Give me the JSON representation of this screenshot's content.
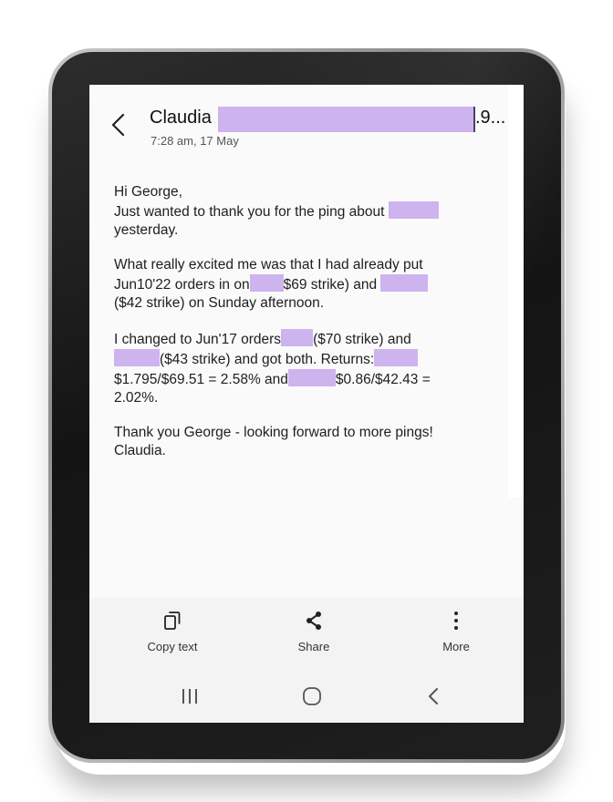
{
  "email": {
    "sender_visible": "Claudia",
    "sender_tail": ".9...",
    "timestamp": "7:28 am, 17 May",
    "greeting": "Hi George,",
    "p1_line1": "Just wanted to thank you for the ping about",
    "p1_line2": "yesterday.",
    "p2_line1": "What really excited me was that I had already put",
    "p2_line2a": "Jun10'22 orders in on",
    "p2_line2b": "$69 strike) and",
    "p2_line3": "($42 strike) on Sunday afternoon.",
    "p3_line1a": "I changed to Jun'17 orders",
    "p3_line1b": "($70 strike) and",
    "p3_line2a": "($43 strike) and got both.  Returns:",
    "p3_line3a": "$1.795/$69.51 = 2.58% and",
    "p3_line3b": "$0.86/$42.43 =",
    "p3_line4": "2.02%.",
    "p4_line1": "Thank you George - looking forward to more pings!",
    "p4_line2": "Claudia."
  },
  "actions": {
    "copy_label": "Copy text",
    "share_label": "Share",
    "more_label": "More"
  },
  "icons": {
    "back": "chevron-left-icon",
    "copy": "copy-icon",
    "share": "share-icon",
    "more": "more-vertical-icon",
    "recent": "recent-apps-icon",
    "home": "home-icon",
    "nav_back": "nav-back-icon"
  },
  "colors": {
    "redaction": "#cdb4ef",
    "screen_bg": "#fafafa",
    "bar_bg": "#f3f3f3"
  }
}
